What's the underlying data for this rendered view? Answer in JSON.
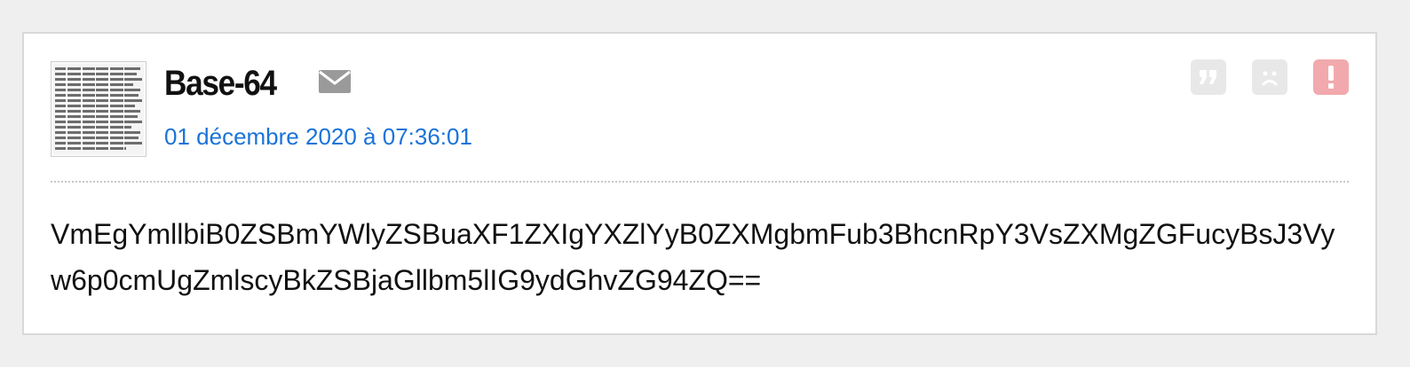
{
  "post": {
    "username": "Base-64",
    "date": "01 décembre 2020 à 07:36:01",
    "message": "VmEgYmllbiB0ZSBmYWlyZSBuaXF1ZXIgYXZlYyB0ZXMgbmFub3BhcnRpY3VsZXMgZGFucyBsJ3Vyw6p0cmUgZmlscyBkZSBjaGllbm5lIG9ydGhvZG94ZQ=="
  },
  "icons": {
    "avatar": "avatar-image",
    "mail": "envelope-icon",
    "quote": "quote-icon",
    "sad": "sad-face-icon",
    "alert": "exclamation-icon"
  },
  "colors": {
    "date_link": "#1a73d9",
    "alert_button": "#f2a9ad",
    "neutral_button": "#e8e8e8"
  }
}
